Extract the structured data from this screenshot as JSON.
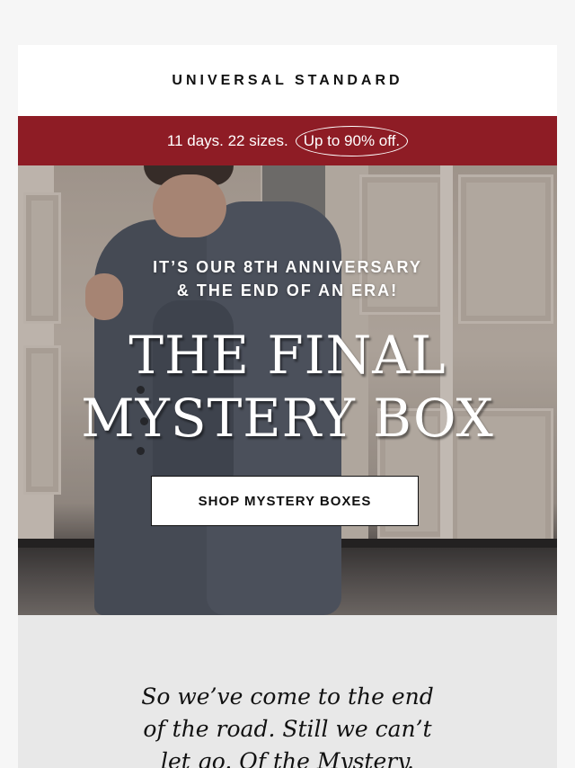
{
  "header": {
    "brand": "UNIVERSAL STANDARD"
  },
  "promo_bar": {
    "text": "11 days. 22 sizes.",
    "circled_text": "Up to 90% off.",
    "background": "#8e1c25"
  },
  "hero": {
    "eyebrow_line1": "IT’S OUR 8TH ANNIVERSARY",
    "eyebrow_line2": "& THE END OF AN ERA!",
    "headline_line1": "THE FINAL",
    "headline_line2": "MYSTERY BOX",
    "cta_label": "SHOP MYSTERY BOXES"
  },
  "body_copy": {
    "line1": "So we’ve come to the end",
    "line2": "of the road. Still we can’t",
    "line3": "let go. Of the Mystery."
  }
}
